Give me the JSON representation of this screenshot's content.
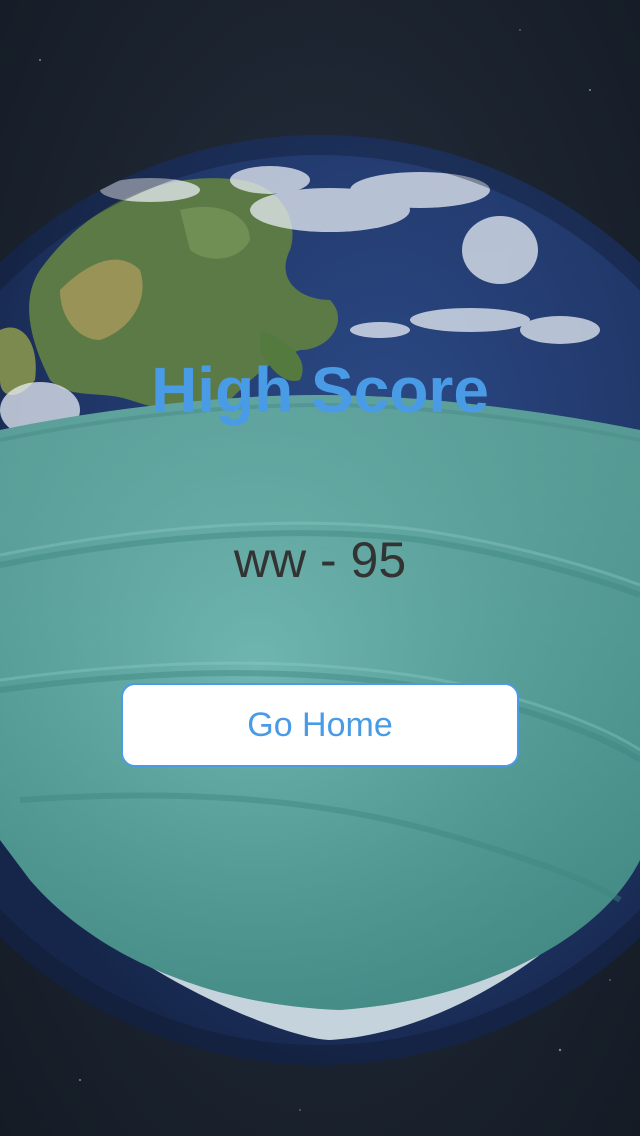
{
  "screen": {
    "title": "High Score",
    "score_entry": "ww - 95",
    "home_button_label": "Go Home"
  },
  "background": {
    "image": "earth-wearing-face-mask",
    "space_color": "#1c2430",
    "mask_color": "#5aa8a3"
  },
  "colors": {
    "accent": "#4a9be6",
    "score_text": "#333333",
    "button_bg": "#ffffff"
  }
}
